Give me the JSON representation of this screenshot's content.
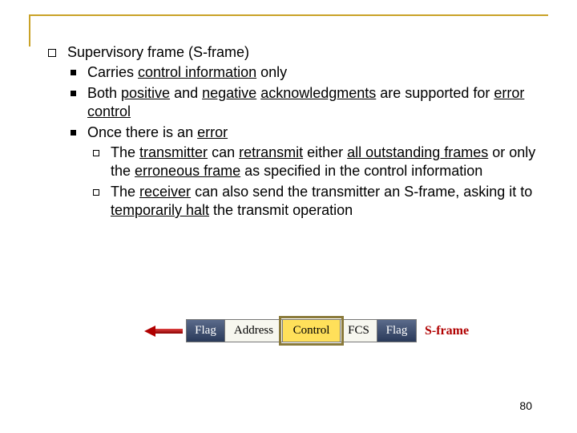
{
  "heading": "Supervisory frame (S-frame)",
  "bullets": {
    "b1_pre": "Carries ",
    "b1_u1": "control information",
    "b1_post": " only",
    "b2_pre": "Both ",
    "b2_u1": "positive",
    "b2_mid1": " and ",
    "b2_u2": "negative",
    "b2_mid2": " ",
    "b2_u3": "acknowledgments",
    "b2_mid3": " are supported for ",
    "b2_u4": "error control",
    "b3_pre": "Once there is an ",
    "b3_u1": "error",
    "b3a_pre": "The ",
    "b3a_u1": "transmitter",
    "b3a_mid1": " can ",
    "b3a_u2": "retransmit",
    "b3a_mid2": " either ",
    "b3a_u3": "all outstanding frames",
    "b3a_mid3": " or only the ",
    "b3a_u4": "erroneous frame",
    "b3a_post": " as specified in the control information",
    "b3b_pre": "The ",
    "b3b_u1": "receiver",
    "b3b_mid1": " can also send the transmitter an S-frame, asking it to ",
    "b3b_u2": "temporarily halt",
    "b3b_post": " the transmit operation"
  },
  "diagram": {
    "flag": "Flag",
    "address": "Address",
    "control": "Control",
    "fcs": "FCS",
    "label": "S-frame"
  },
  "page": "80"
}
